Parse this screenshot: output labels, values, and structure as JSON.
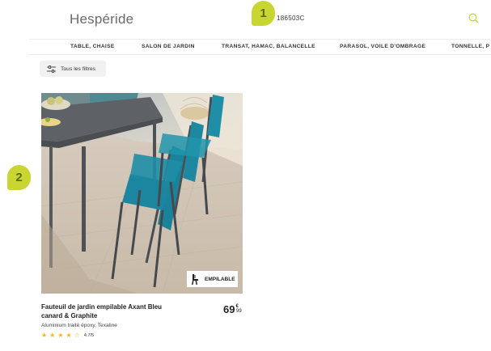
{
  "header": {
    "logo_text": "Hespéride",
    "search_value": "186503C"
  },
  "annotations": [
    "1",
    "2"
  ],
  "nav": {
    "items": [
      {
        "label": "TABLE, CHAISE"
      },
      {
        "label": "SALON DE JARDIN"
      },
      {
        "label": "TRANSAT, HAMAC, BALANCELLE"
      },
      {
        "label": "PARASOL, VOILE D'OMBRAGE"
      },
      {
        "label": "TONNELLE, P"
      }
    ]
  },
  "filters": {
    "label": "Tous les filtres"
  },
  "product": {
    "badge": "EMPILABLE",
    "title": "Fauteuil de jardin empilable Axant Bleu canard & Graphite",
    "material": "Aluminium traité époxy, Texaline",
    "price_int": "69",
    "price_currency": "€",
    "price_dec": "99",
    "rating_stars": 4.5,
    "rating_text": "4.7/5"
  },
  "colors": {
    "accent": "#c9d632",
    "star": "#f5b51c",
    "search_icon": "#c9d632"
  }
}
